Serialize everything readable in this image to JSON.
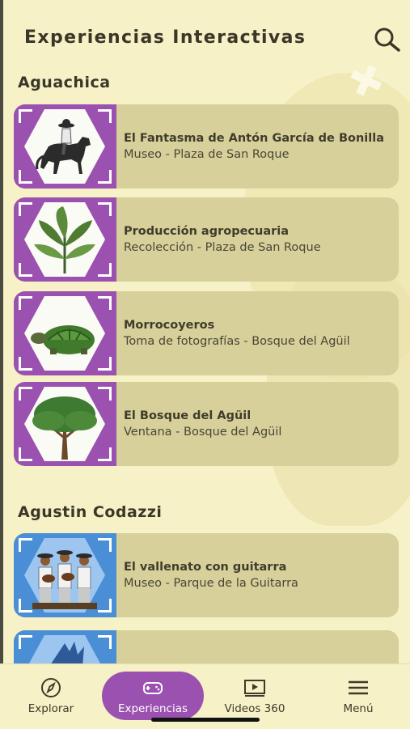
{
  "header": {
    "title": "Experiencias Interactivas",
    "search_icon": "search-icon"
  },
  "sections": [
    {
      "name": "Aguachica",
      "items": [
        {
          "title": "El Fantasma de Antón García de Bonilla",
          "subtitle": "Museo - Plaza de San Roque",
          "thumb_color": "#9a51b0",
          "icon": "horse-rider-icon"
        },
        {
          "title": "Producción agropecuaria",
          "subtitle": "Recolección - Plaza de San Roque",
          "thumb_color": "#9a51b0",
          "icon": "plant-icon"
        },
        {
          "title": "Morrocoyeros",
          "subtitle": "Toma de fotografías - Bosque del Agüil",
          "thumb_color": "#9a51b0",
          "icon": "turtle-icon"
        },
        {
          "title": "El Bosque del Agüil",
          "subtitle": "Ventana - Bosque del Agüil",
          "thumb_color": "#9a51b0",
          "icon": "tree-icon"
        }
      ]
    },
    {
      "name": "Agustin Codazzi",
      "items": [
        {
          "title": "El vallenato con guitarra",
          "subtitle": "Museo - Parque de la Guitarra",
          "thumb_color": "#4a8fd6",
          "icon": "musicians-icon"
        }
      ]
    }
  ],
  "nav": {
    "items": [
      {
        "label": "Explorar",
        "icon": "compass-icon"
      },
      {
        "label": "Experiencias",
        "icon": "gamepad-icon",
        "active": true
      },
      {
        "label": "Videos 360",
        "icon": "video-play-icon"
      },
      {
        "label": "Menú",
        "icon": "hamburger-menu-icon"
      }
    ]
  },
  "colors": {
    "background": "#f6f1c6",
    "card": "#d7d09a",
    "accent_purple": "#9a51b0",
    "accent_blue": "#4a8fd6"
  }
}
